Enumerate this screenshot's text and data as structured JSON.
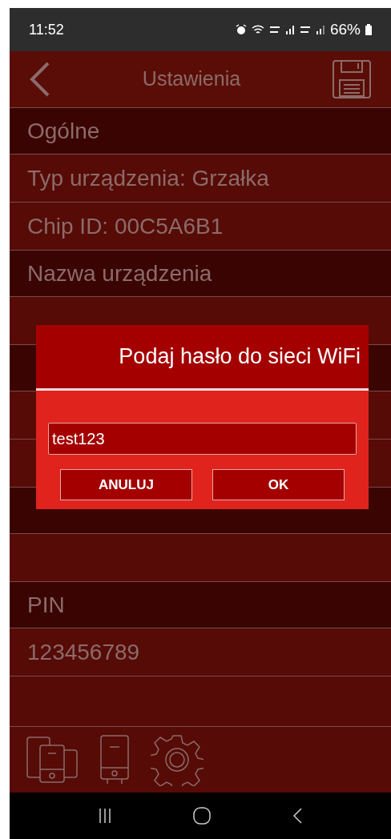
{
  "status_bar": {
    "time": "11:52",
    "battery": "66%"
  },
  "header": {
    "title": "Ustawienia"
  },
  "rows": [
    {
      "kind": "section",
      "label": "Ogólne"
    },
    {
      "kind": "item",
      "label": "Typ urządzenia: Grzałka"
    },
    {
      "kind": "item",
      "label": "Chip ID: 00C5A6B1"
    },
    {
      "kind": "section",
      "label": "Nazwa urządzenia"
    },
    {
      "kind": "item"
    },
    {
      "kind": "section"
    },
    {
      "kind": "item"
    },
    {
      "kind": "item"
    },
    {
      "kind": "section"
    },
    {
      "kind": "item"
    },
    {
      "kind": "section",
      "label": "PIN"
    },
    {
      "kind": "item",
      "label": "123456789"
    }
  ],
  "dialog": {
    "title": "Podaj hasło do sieci WiFi",
    "value": "test123",
    "buttons": [
      "ANULUJ",
      "OK"
    ]
  }
}
